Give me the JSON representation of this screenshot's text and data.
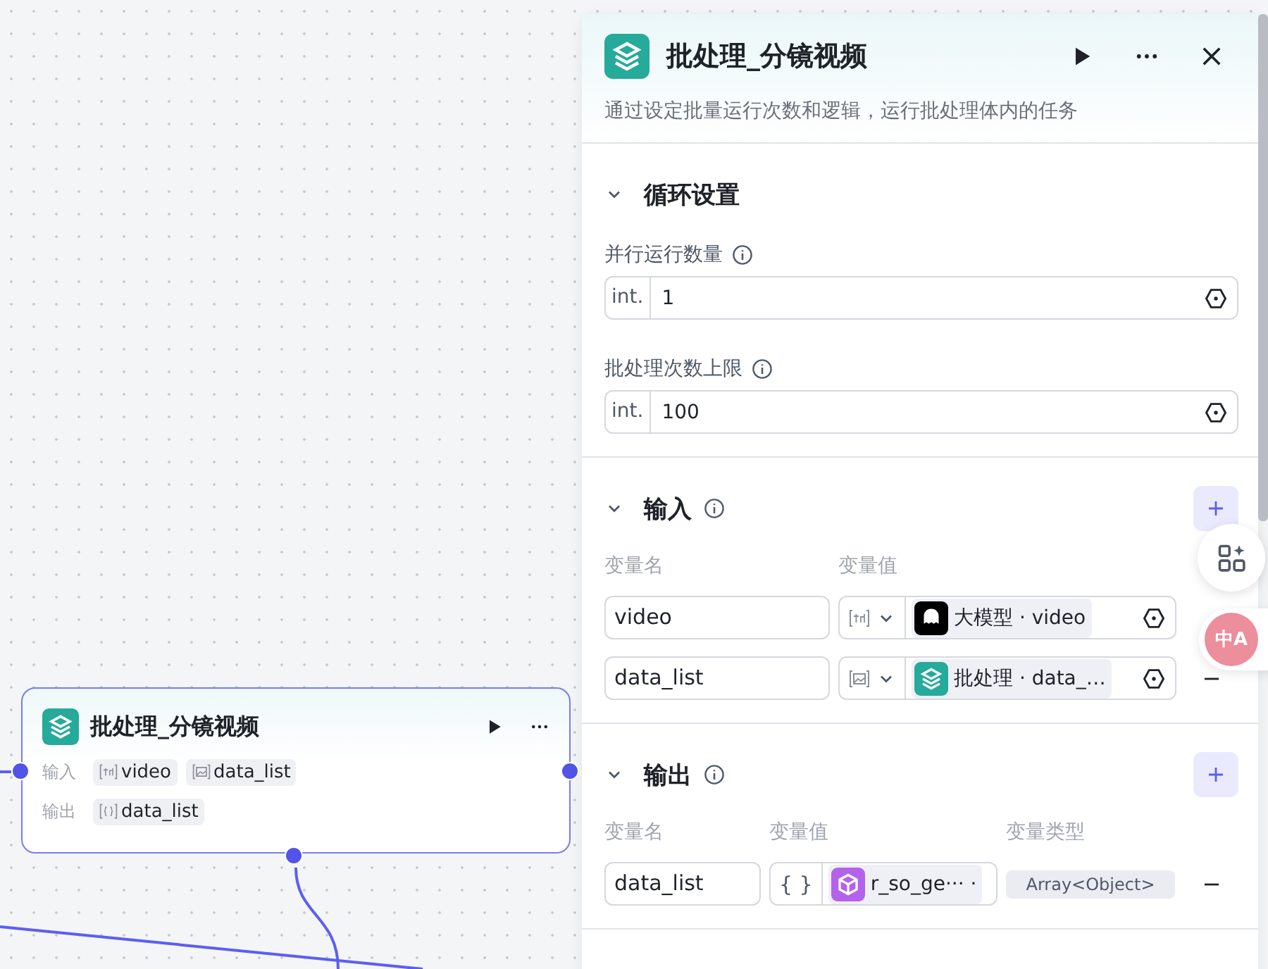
{
  "canvas_node": {
    "title": "批处理_分镜视频",
    "ports": {
      "left": true,
      "right": true,
      "bottom": true
    },
    "rows": [
      {
        "label": "输入",
        "chips": [
          {
            "type_icon": {
              "kind": "string"
            },
            "text": "video"
          },
          {
            "type_icon": {
              "kind": "image"
            },
            "text": "data_list"
          }
        ]
      },
      {
        "label": "输出",
        "chips": [
          {
            "type_icon": {
              "kind": "object"
            },
            "text": "data_list"
          }
        ]
      }
    ]
  },
  "panel": {
    "title": "批处理_分镜视频",
    "description": "通过设定批量运行次数和逻辑，运行批处理体内的任务",
    "sections": [
      {
        "kind": "settings",
        "title": "循环设置",
        "expanded": true,
        "info": false,
        "fields": [
          {
            "label": "并行运行数量",
            "info": true,
            "type_tag": "int.",
            "value": "1"
          },
          {
            "label": "批处理次数上限",
            "info": true,
            "type_tag": "int.",
            "value": "100"
          }
        ]
      },
      {
        "kind": "inputs",
        "title": "输入",
        "expanded": true,
        "info": true,
        "headers": [
          "变量名",
          "变量值"
        ],
        "rows": [
          {
            "name": "video",
            "type_icon": {
              "kind": "string"
            },
            "source_icon": {
              "kind": "llm"
            },
            "reference": "大模型 · video"
          },
          {
            "name": "data_list",
            "type_icon": {
              "kind": "image"
            },
            "source_icon": {
              "kind": "batch"
            },
            "reference": "批处理 · data_…"
          }
        ]
      },
      {
        "kind": "outputs",
        "title": "输出",
        "expanded": true,
        "info": true,
        "headers": [
          "变量名",
          "变量值",
          "变量类型"
        ],
        "rows": [
          {
            "name": "data_list",
            "type_text": "{ }",
            "source_icon": {
              "kind": "code"
            },
            "reference": "r_so_ge··· ·",
            "var_type": "Array<Object>"
          }
        ]
      }
    ]
  },
  "floating": {
    "translate_label": "中A"
  }
}
